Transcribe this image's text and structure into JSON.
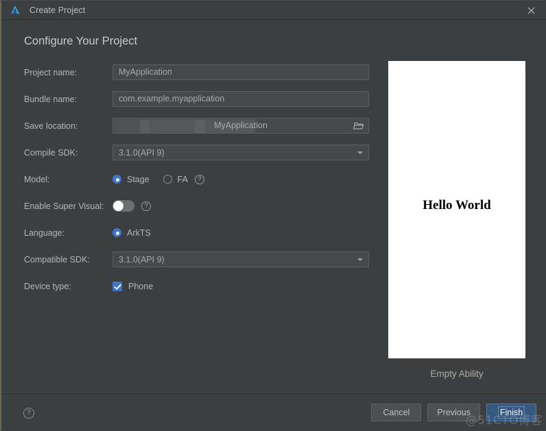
{
  "window": {
    "title": "Create Project",
    "logo_icon": "deveco-studio-logo",
    "close_icon": "close-icon"
  },
  "heading": "Configure Your Project",
  "form": {
    "project_name": {
      "label": "Project name:",
      "value": "MyApplication",
      "placeholder": "MyApplication"
    },
    "bundle_name": {
      "label": "Bundle name:",
      "value": "com.example.myapplication",
      "placeholder": "com.example.myapplication"
    },
    "save_location": {
      "label": "Save location:",
      "value": "MyApplication",
      "browse_icon": "folder-open-icon"
    },
    "compile_sdk": {
      "label": "Compile SDK:",
      "value": "3.1.0(API 9)",
      "arrow_icon": "chevron-down-icon"
    },
    "model": {
      "label": "Model:",
      "options": [
        {
          "label": "Stage",
          "selected": true
        },
        {
          "label": "FA",
          "selected": false
        }
      ],
      "help_icon": "help-icon",
      "help_label": "?"
    },
    "enable_super_visual": {
      "label": "Enable Super Visual:",
      "enabled": false,
      "help_icon": "help-icon",
      "help_label": "?"
    },
    "language": {
      "label": "Language:",
      "options": [
        {
          "label": "ArkTS",
          "selected": true
        }
      ]
    },
    "compatible_sdk": {
      "label": "Compatible SDK:",
      "value": "3.1.0(API 9)",
      "arrow_icon": "chevron-down-icon"
    },
    "device_type": {
      "label": "Device type:",
      "options": [
        {
          "label": "Phone",
          "checked": true
        }
      ]
    }
  },
  "preview": {
    "screen_text": "Hello World",
    "caption": "Empty Ability"
  },
  "footer": {
    "help_label": "?",
    "help_icon": "help-icon",
    "buttons": [
      {
        "label": "Cancel",
        "primary": false
      },
      {
        "label": "Previous",
        "primary": false
      },
      {
        "label": "Finish",
        "primary": true
      }
    ]
  },
  "watermark": "@51CTO博客",
  "colors": {
    "accent": "#3f76c4",
    "primary_button": "#365880",
    "dialog_bg": "#3c3f41",
    "field_bg": "#45494a",
    "left_border": "#6e6a4a"
  }
}
